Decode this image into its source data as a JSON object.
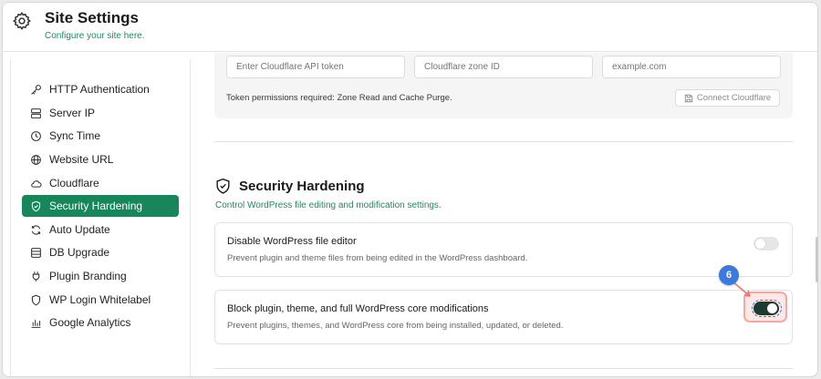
{
  "header": {
    "title": "Site Settings",
    "subtitle": "Configure your site here.",
    "icon": "gear-icon"
  },
  "sidebar": {
    "items": [
      {
        "label": "HTTP Authentication",
        "icon": "key-icon"
      },
      {
        "label": "Server IP",
        "icon": "server-icon"
      },
      {
        "label": "Sync Time",
        "icon": "clock-icon"
      },
      {
        "label": "Website URL",
        "icon": "globe-icon"
      },
      {
        "label": "Cloudflare",
        "icon": "cloud-icon"
      },
      {
        "label": "Security Hardening",
        "icon": "shield-icon",
        "active": true
      },
      {
        "label": "Auto Update",
        "icon": "refresh-icon"
      },
      {
        "label": "DB Upgrade",
        "icon": "database-icon"
      },
      {
        "label": "Plugin Branding",
        "icon": "plug-icon"
      },
      {
        "label": "WP Login Whitelabel",
        "icon": "shield-outline-icon"
      },
      {
        "label": "Google Analytics",
        "icon": "bar-chart-icon"
      }
    ]
  },
  "cloudflare": {
    "api_token_placeholder": "Enter Cloudflare API token",
    "zone_id_placeholder": "Cloudflare zone ID",
    "domain_placeholder": "example.com",
    "note": "Token permissions required: Zone Read and Cache Purge.",
    "connect_label": "Connect Cloudflare"
  },
  "security": {
    "title": "Security Hardening",
    "subtitle": "Control WordPress file editing and modification settings.",
    "options": [
      {
        "title": "Disable WordPress file editor",
        "description": "Prevent plugin and theme files from being edited in the WordPress dashboard.",
        "enabled": false
      },
      {
        "title": "Block plugin, theme, and full WordPress core modifications",
        "description": "Prevent plugins, themes, and WordPress core from being installed, updated, or deleted.",
        "enabled": true
      }
    ]
  },
  "annotation": {
    "step": "6"
  },
  "colors": {
    "accent": "#17865a",
    "toggle_on": "#1d3b31",
    "badge": "#3b78e0",
    "highlight": "#f2a8a4"
  }
}
